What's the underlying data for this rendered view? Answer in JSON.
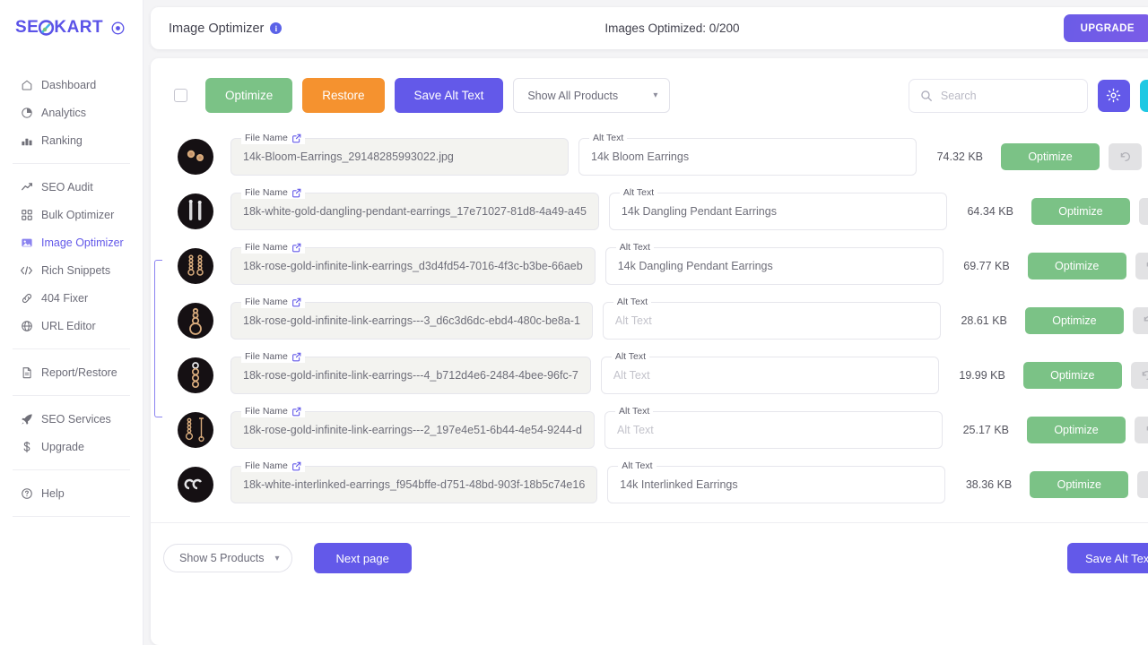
{
  "brand": {
    "name_part1": "SE",
    "name_part2": "KART",
    "accent": "#5b53e8",
    "logo_icon": "rocket-gear-icon",
    "badge_icon": "target-circle-icon"
  },
  "sidebar": {
    "groups": [
      {
        "items": [
          {
            "label": "Dashboard",
            "icon": "home-icon",
            "active": false
          },
          {
            "label": "Analytics",
            "icon": "pie-clock-icon",
            "active": false
          },
          {
            "label": "Ranking",
            "icon": "bar-chart-icon",
            "active": false
          }
        ]
      },
      {
        "items": [
          {
            "label": "SEO Audit",
            "icon": "trend-up-icon",
            "active": false
          },
          {
            "label": "Bulk Optimizer",
            "icon": "grid-squares-icon",
            "active": false
          },
          {
            "label": "Image Optimizer",
            "icon": "image-icon",
            "active": true
          },
          {
            "label": "Rich Snippets",
            "icon": "code-brackets-icon",
            "active": false
          },
          {
            "label": "404 Fixer",
            "icon": "link-chain-icon",
            "active": false
          },
          {
            "label": "URL Editor",
            "icon": "globe-icon",
            "active": false
          }
        ]
      },
      {
        "items": [
          {
            "label": "Report/Restore",
            "icon": "document-icon",
            "active": false
          }
        ]
      },
      {
        "items": [
          {
            "label": "SEO Services",
            "icon": "rocket-icon",
            "active": false
          },
          {
            "label": "Upgrade",
            "icon": "dollar-icon",
            "active": false
          }
        ]
      },
      {
        "items": [
          {
            "label": "Help",
            "icon": "question-circle-icon",
            "active": false
          }
        ]
      }
    ]
  },
  "header": {
    "title": "Image Optimizer",
    "info_icon": "info-icon",
    "counter": "Images Optimized: 0/200",
    "upgrade_label": "UPGRADE",
    "expand_icon": "fullscreen-expand-icon"
  },
  "toolbar": {
    "select_all_checkbox": "unchecked",
    "optimize_label": "Optimize",
    "restore_label": "Restore",
    "save_alt_text_label": "Save Alt Text",
    "filter_value": "Show All Products",
    "filter_chevron": "chevron-down-icon",
    "search": {
      "value": "",
      "placeholder": "Search",
      "icon": "search-icon"
    },
    "settings_icon": "gear-icon",
    "refresh_icon": "refresh-sync-icon",
    "accent_purple": "#6359e9",
    "accent_cyan": "#1fc8e3",
    "accent_green": "#7bc286",
    "accent_orange": "#f5922f"
  },
  "table": {
    "file_name_label": "File Name",
    "alt_text_label": "Alt Text",
    "alt_text_placeholder": "Alt Text",
    "open_link_icon": "external-link-icon",
    "row_optimize_label": "Optimize",
    "row_undo_icon": "undo-restore-icon",
    "selection_bracket": {
      "from_row": 3,
      "to_row": 6,
      "color": "#8b83f0"
    },
    "rows": [
      {
        "thumb": "bloom-earrings-thumb",
        "file_name": "14k-Bloom-Earrings_29148285993022.jpg",
        "alt_text": "14k Bloom Earrings",
        "size": "74.32 KB"
      },
      {
        "thumb": "white-gold-dangling-pendant-earrings-thumb",
        "file_name": "18k-white-gold-dangling-pendant-earrings_17e71027-81d8-4a49-a45",
        "alt_text": "14k Dangling Pendant Earrings",
        "size": "64.34 KB"
      },
      {
        "thumb": "rose-gold-infinite-link-earrings-thumb",
        "file_name": "18k-rose-gold-infinite-link-earrings_d3d4fd54-7016-4f3c-b3be-66aeb",
        "alt_text": "14k Dangling Pendant Earrings",
        "size": "69.77 KB"
      },
      {
        "thumb": "rose-gold-infinite-link-earrings-3-thumb",
        "file_name": "18k-rose-gold-infinite-link-earrings---3_d6c3d6dc-ebd4-480c-be8a-1",
        "alt_text": "",
        "size": "28.61 KB"
      },
      {
        "thumb": "rose-gold-infinite-link-earrings-4-thumb",
        "file_name": "18k-rose-gold-infinite-link-earrings---4_b712d4e6-2484-4bee-96fc-7",
        "alt_text": "",
        "size": "19.99 KB"
      },
      {
        "thumb": "rose-gold-infinite-link-earrings-2-thumb",
        "file_name": "18k-rose-gold-infinite-link-earrings---2_197e4e51-6b44-4e54-9244-d",
        "alt_text": "",
        "size": "25.17 KB"
      },
      {
        "thumb": "white-interlinked-earrings-thumb",
        "file_name": "18k-white-interlinked-earrings_f954bffe-d751-48bd-903f-18b5c74e16",
        "alt_text": "14k Interlinked Earrings",
        "size": "38.36 KB"
      }
    ]
  },
  "footer": {
    "per_page_value": "Show 5 Products",
    "per_page_chevron": "chevron-down-icon",
    "next_page_label": "Next page",
    "save_alt_text_label": "Save Alt Text"
  }
}
